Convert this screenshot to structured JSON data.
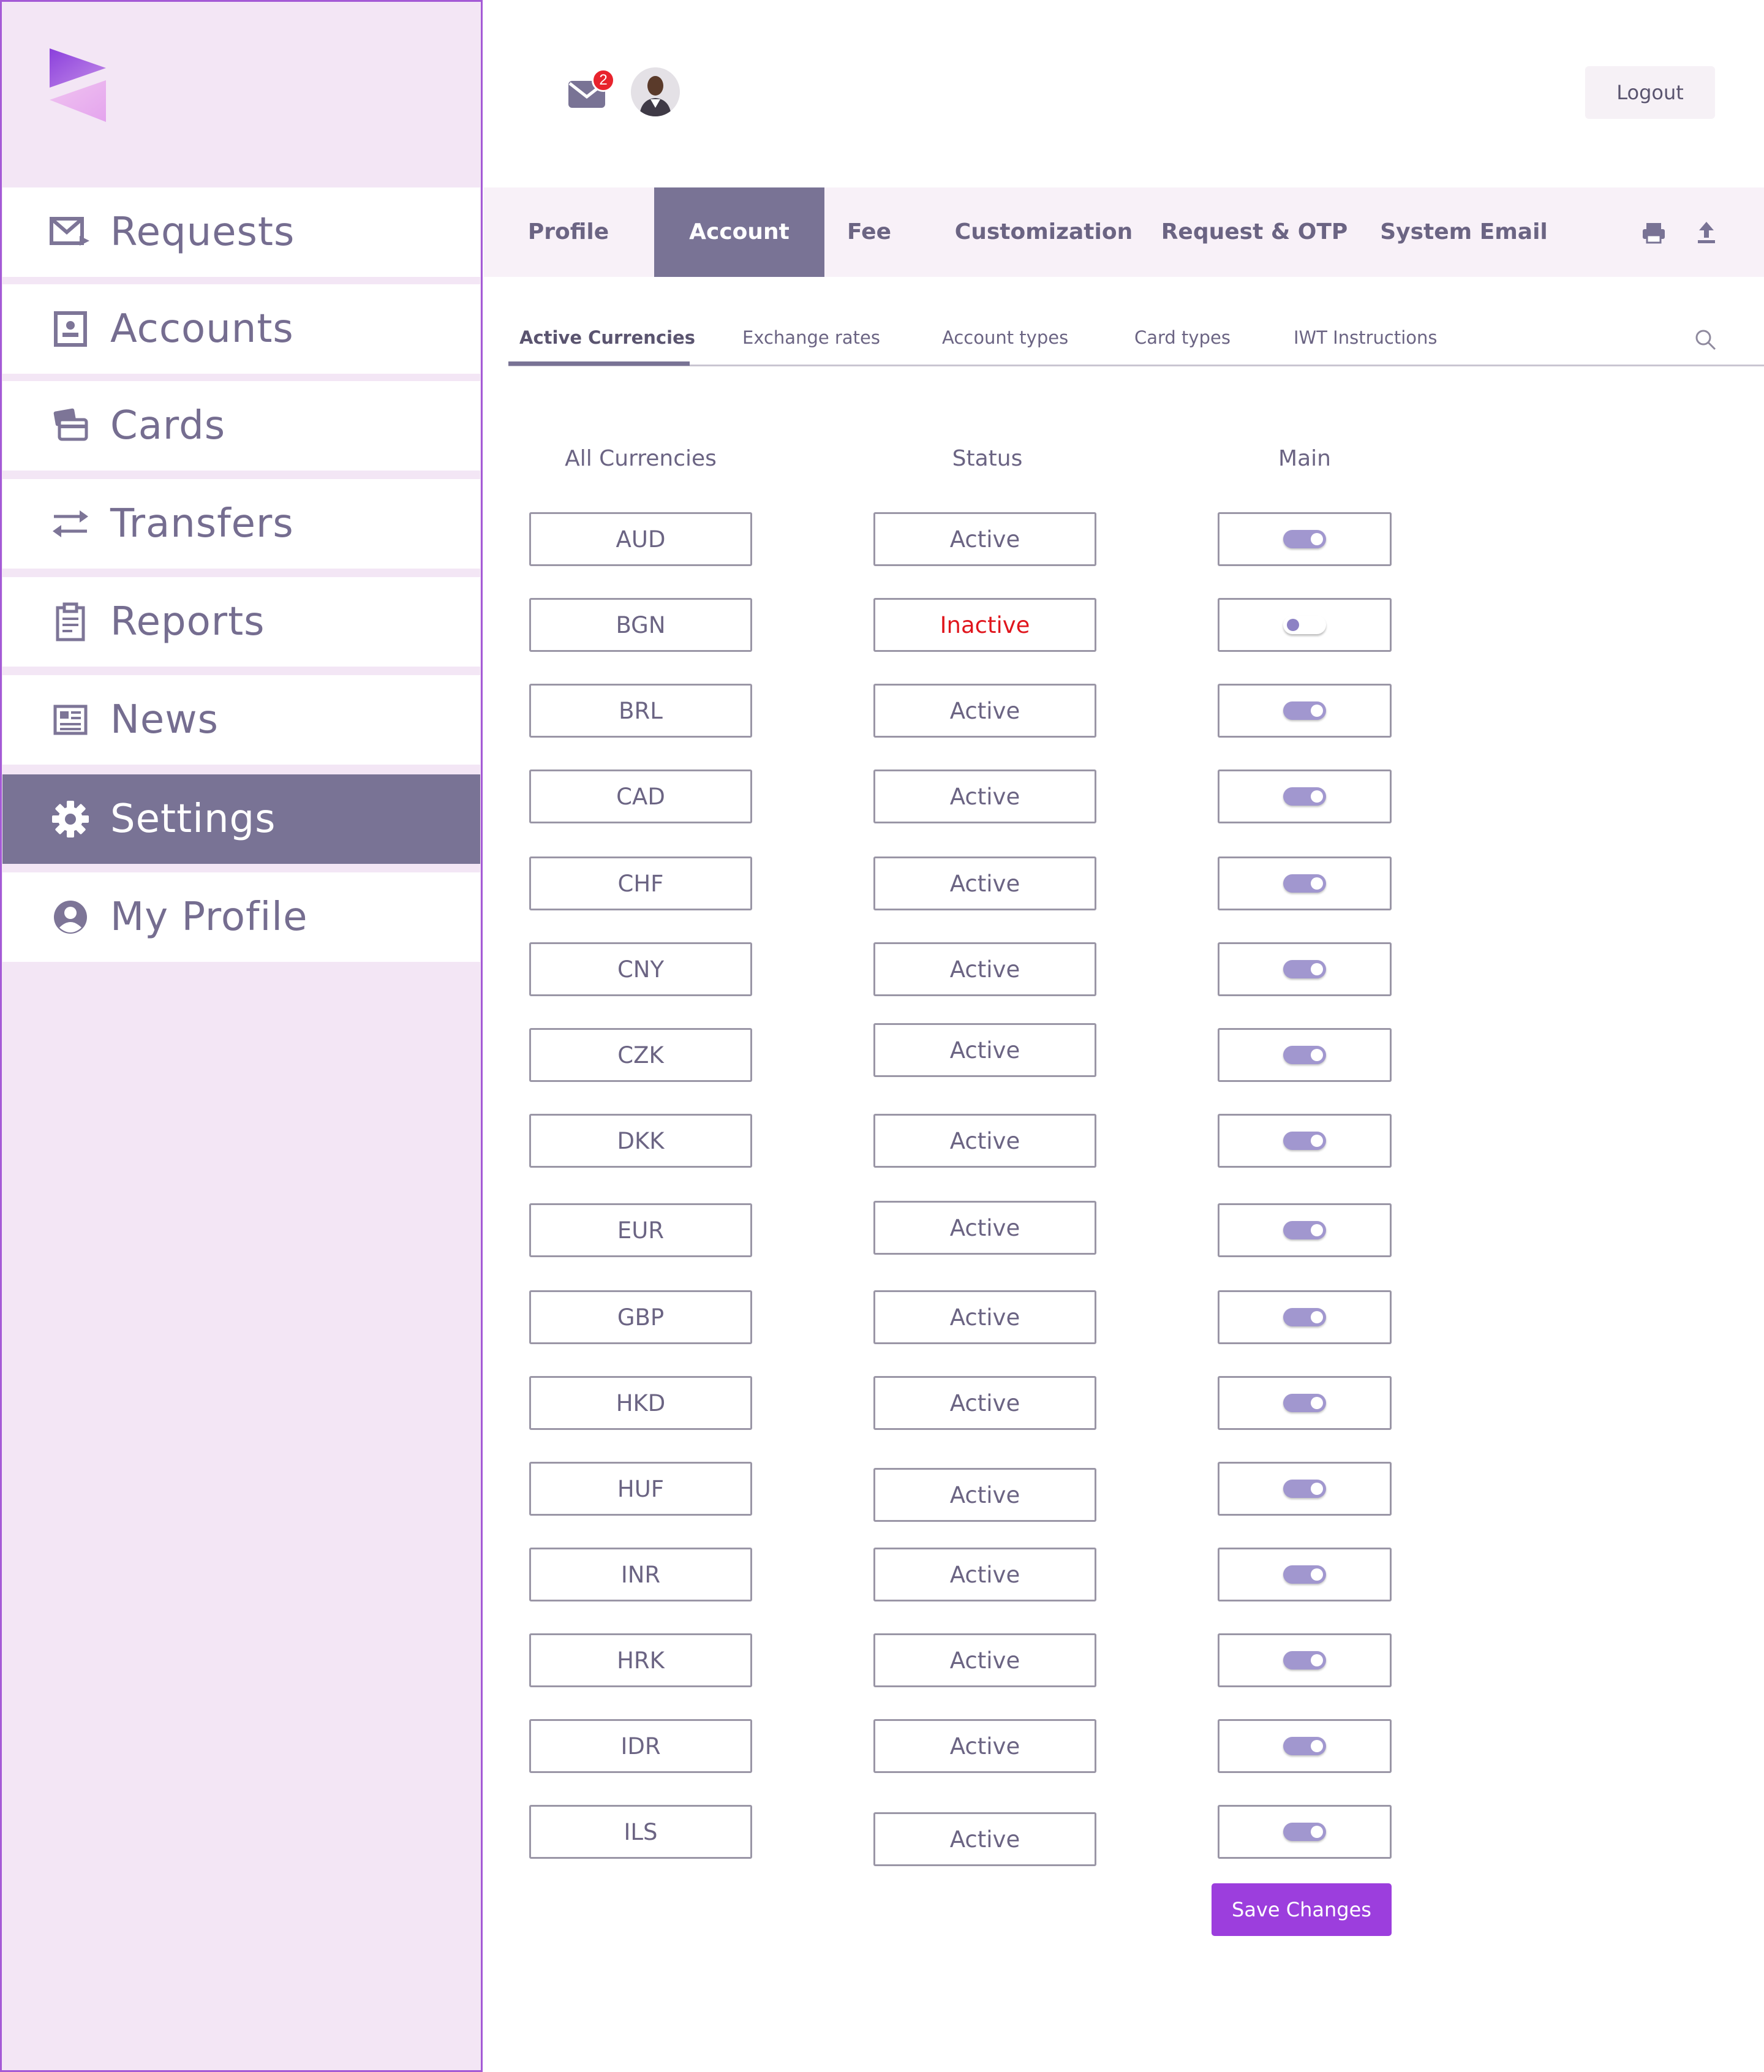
{
  "colors": {
    "accent": "#797395",
    "sidebar_bg": "#f3e6f5",
    "save_button": "#9c3edd",
    "inactive_text": "#e0161d",
    "toggle_on": "#a197cf"
  },
  "sidebar": {
    "items": [
      {
        "label": "Requests",
        "icon": "mail-arrow-icon",
        "active": false
      },
      {
        "label": "Accounts",
        "icon": "contact-card-icon",
        "active": false
      },
      {
        "label": "Cards",
        "icon": "cards-icon",
        "active": false
      },
      {
        "label": "Transfers",
        "icon": "transfer-arrows-icon",
        "active": false
      },
      {
        "label": "Reports",
        "icon": "clipboard-icon",
        "active": false
      },
      {
        "label": "News",
        "icon": "newspaper-icon",
        "active": false
      },
      {
        "label": "Settings",
        "icon": "gear-icon",
        "active": true
      },
      {
        "label": "My Profile",
        "icon": "user-circle-icon",
        "active": false
      }
    ]
  },
  "header": {
    "mail_badge": "2",
    "logout_label": "Logout"
  },
  "tabs": {
    "items": [
      "Profile",
      "Account",
      "Fee",
      "Customization",
      "Request & OTP",
      "System Email"
    ],
    "active": "Account"
  },
  "subtabs": {
    "items": [
      "Active Currencies",
      "Exchange rates",
      "Account types",
      "Card types",
      "IWT Instructions"
    ],
    "active": "Active Currencies"
  },
  "table": {
    "headers": {
      "currency": "All Currencies",
      "status": "Status",
      "main": "Main"
    },
    "rows": [
      {
        "currency": "AUD",
        "status": "Active",
        "main": true
      },
      {
        "currency": "BGN",
        "status": "Inactive",
        "main": false
      },
      {
        "currency": "BRL",
        "status": "Active",
        "main": true
      },
      {
        "currency": "CAD",
        "status": "Active",
        "main": true
      },
      {
        "currency": "CHF",
        "status": "Active",
        "main": true
      },
      {
        "currency": "CNY",
        "status": "Active",
        "main": true
      },
      {
        "currency": "CZK",
        "status": "Active",
        "main": true
      },
      {
        "currency": "DKK",
        "status": "Active",
        "main": true
      },
      {
        "currency": "EUR",
        "status": "Active",
        "main": true
      },
      {
        "currency": "GBP",
        "status": "Active",
        "main": true
      },
      {
        "currency": "HKD",
        "status": "Active",
        "main": true
      },
      {
        "currency": "HUF",
        "status": "Active",
        "main": true
      },
      {
        "currency": "INR",
        "status": "Active",
        "main": true
      },
      {
        "currency": "HRK",
        "status": "Active",
        "main": true
      },
      {
        "currency": "IDR",
        "status": "Active",
        "main": true
      },
      {
        "currency": "ILS",
        "status": "Active",
        "main": true
      }
    ]
  },
  "save_label": "Save Changes"
}
